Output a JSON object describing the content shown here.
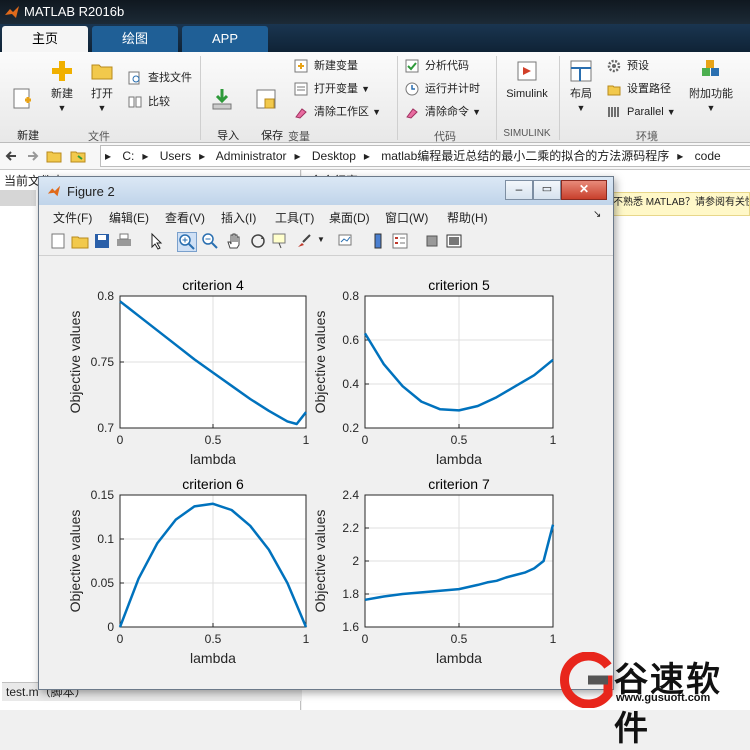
{
  "app": {
    "title": "MATLAB R2016b"
  },
  "tabs": [
    "主页",
    "绘图",
    "APP"
  ],
  "ribbon": {
    "new_script": "新建\n脚本",
    "new": "新建",
    "open": "打开",
    "find_files": "查找文件",
    "compare": "比较",
    "import_data": "导入\n数据",
    "save_workspace": "保存\n工作区",
    "new_variable": "新建变量",
    "open_variable": "打开变量",
    "clear_workspace": "清除工作区",
    "analyze_code": "分析代码",
    "run_and_time": "运行并计时",
    "clear_commands": "清除命令",
    "simulink": "Simulink",
    "layout": "布局",
    "preferences": "预设",
    "set_path": "设置路径",
    "parallel": "Parallel",
    "addons": "附加功能",
    "groups": {
      "file": "文件",
      "variable": "变量",
      "code": "代码",
      "simulink": "SIMULINK",
      "environment": "环境"
    }
  },
  "address": {
    "segments": [
      "C:",
      "Users",
      "Administrator",
      "Desktop",
      "matlab编程最近总结的最小二乘的拟合的方法源码程序",
      "code"
    ]
  },
  "left_pane": {
    "header": "当前文件夹",
    "footer": "test.m（脚本）"
  },
  "right_pane": {
    "header": "命令行窗口",
    "notice": "不熟悉 MATLAB？请参阅有关快速入门的资源。"
  },
  "figure": {
    "title": "Figure 2",
    "menu": [
      "文件(F)",
      "编辑(E)",
      "查看(V)",
      "插入(I)",
      "工具(T)",
      "桌面(D)",
      "窗口(W)",
      "帮助(H)"
    ]
  },
  "chart_data": [
    {
      "type": "line",
      "title": "criterion 4",
      "xlabel": "lambda",
      "ylabel": "Objective values",
      "xlim": [
        0,
        1
      ],
      "ylim": [
        0.7,
        0.8
      ],
      "xticks": [
        "0",
        "0.5",
        "1"
      ],
      "yticks": [
        "0.7",
        "0.75",
        "0.8"
      ],
      "grid": true,
      "color": "#0072BD",
      "x": [
        0,
        0.1,
        0.2,
        0.3,
        0.4,
        0.5,
        0.6,
        0.7,
        0.8,
        0.9,
        0.95,
        1.0
      ],
      "y": [
        0.796,
        0.785,
        0.774,
        0.763,
        0.752,
        0.742,
        0.732,
        0.722,
        0.713,
        0.705,
        0.703,
        0.712
      ]
    },
    {
      "type": "line",
      "title": "criterion 5",
      "xlabel": "lambda",
      "ylabel": "Objective values",
      "xlim": [
        0,
        1
      ],
      "ylim": [
        0.2,
        0.8
      ],
      "xticks": [
        "0",
        "0.5",
        "1"
      ],
      "yticks": [
        "0.2",
        "0.4",
        "0.6",
        "0.8"
      ],
      "grid": true,
      "color": "#0072BD",
      "x": [
        0,
        0.1,
        0.2,
        0.3,
        0.4,
        0.5,
        0.6,
        0.7,
        0.8,
        0.9,
        1.0
      ],
      "y": [
        0.63,
        0.49,
        0.39,
        0.32,
        0.285,
        0.28,
        0.3,
        0.34,
        0.39,
        0.44,
        0.51
      ]
    },
    {
      "type": "line",
      "title": "criterion 6",
      "xlabel": "lambda",
      "ylabel": "Objective values",
      "xlim": [
        0,
        1
      ],
      "ylim": [
        0,
        0.15
      ],
      "xticks": [
        "0",
        "0.5",
        "1"
      ],
      "yticks": [
        "0",
        "0.05",
        "0.1",
        "0.15"
      ],
      "grid": true,
      "color": "#0072BD",
      "x": [
        0,
        0.1,
        0.2,
        0.3,
        0.4,
        0.5,
        0.6,
        0.7,
        0.8,
        0.9,
        1.0
      ],
      "y": [
        0,
        0.055,
        0.095,
        0.122,
        0.137,
        0.14,
        0.133,
        0.115,
        0.088,
        0.05,
        0
      ]
    },
    {
      "type": "line",
      "title": "criterion 7",
      "xlabel": "lambda",
      "ylabel": "Objective values",
      "xlim": [
        0,
        1
      ],
      "ylim": [
        1.6,
        2.4
      ],
      "xticks": [
        "0",
        "0.5",
        "1"
      ],
      "yticks": [
        "1.6",
        "1.8",
        "2",
        "2.2",
        "2.4"
      ],
      "grid": true,
      "color": "#0072BD",
      "x": [
        0,
        0.1,
        0.2,
        0.3,
        0.4,
        0.5,
        0.6,
        0.65,
        0.7,
        0.75,
        0.8,
        0.85,
        0.9,
        0.95,
        1.0
      ],
      "y": [
        1.765,
        1.785,
        1.8,
        1.81,
        1.82,
        1.83,
        1.855,
        1.87,
        1.88,
        1.9,
        1.915,
        1.93,
        1.955,
        2.0,
        2.22
      ]
    }
  ],
  "watermark": {
    "brand": "谷速软件",
    "url": "www.gusuoft.com"
  }
}
